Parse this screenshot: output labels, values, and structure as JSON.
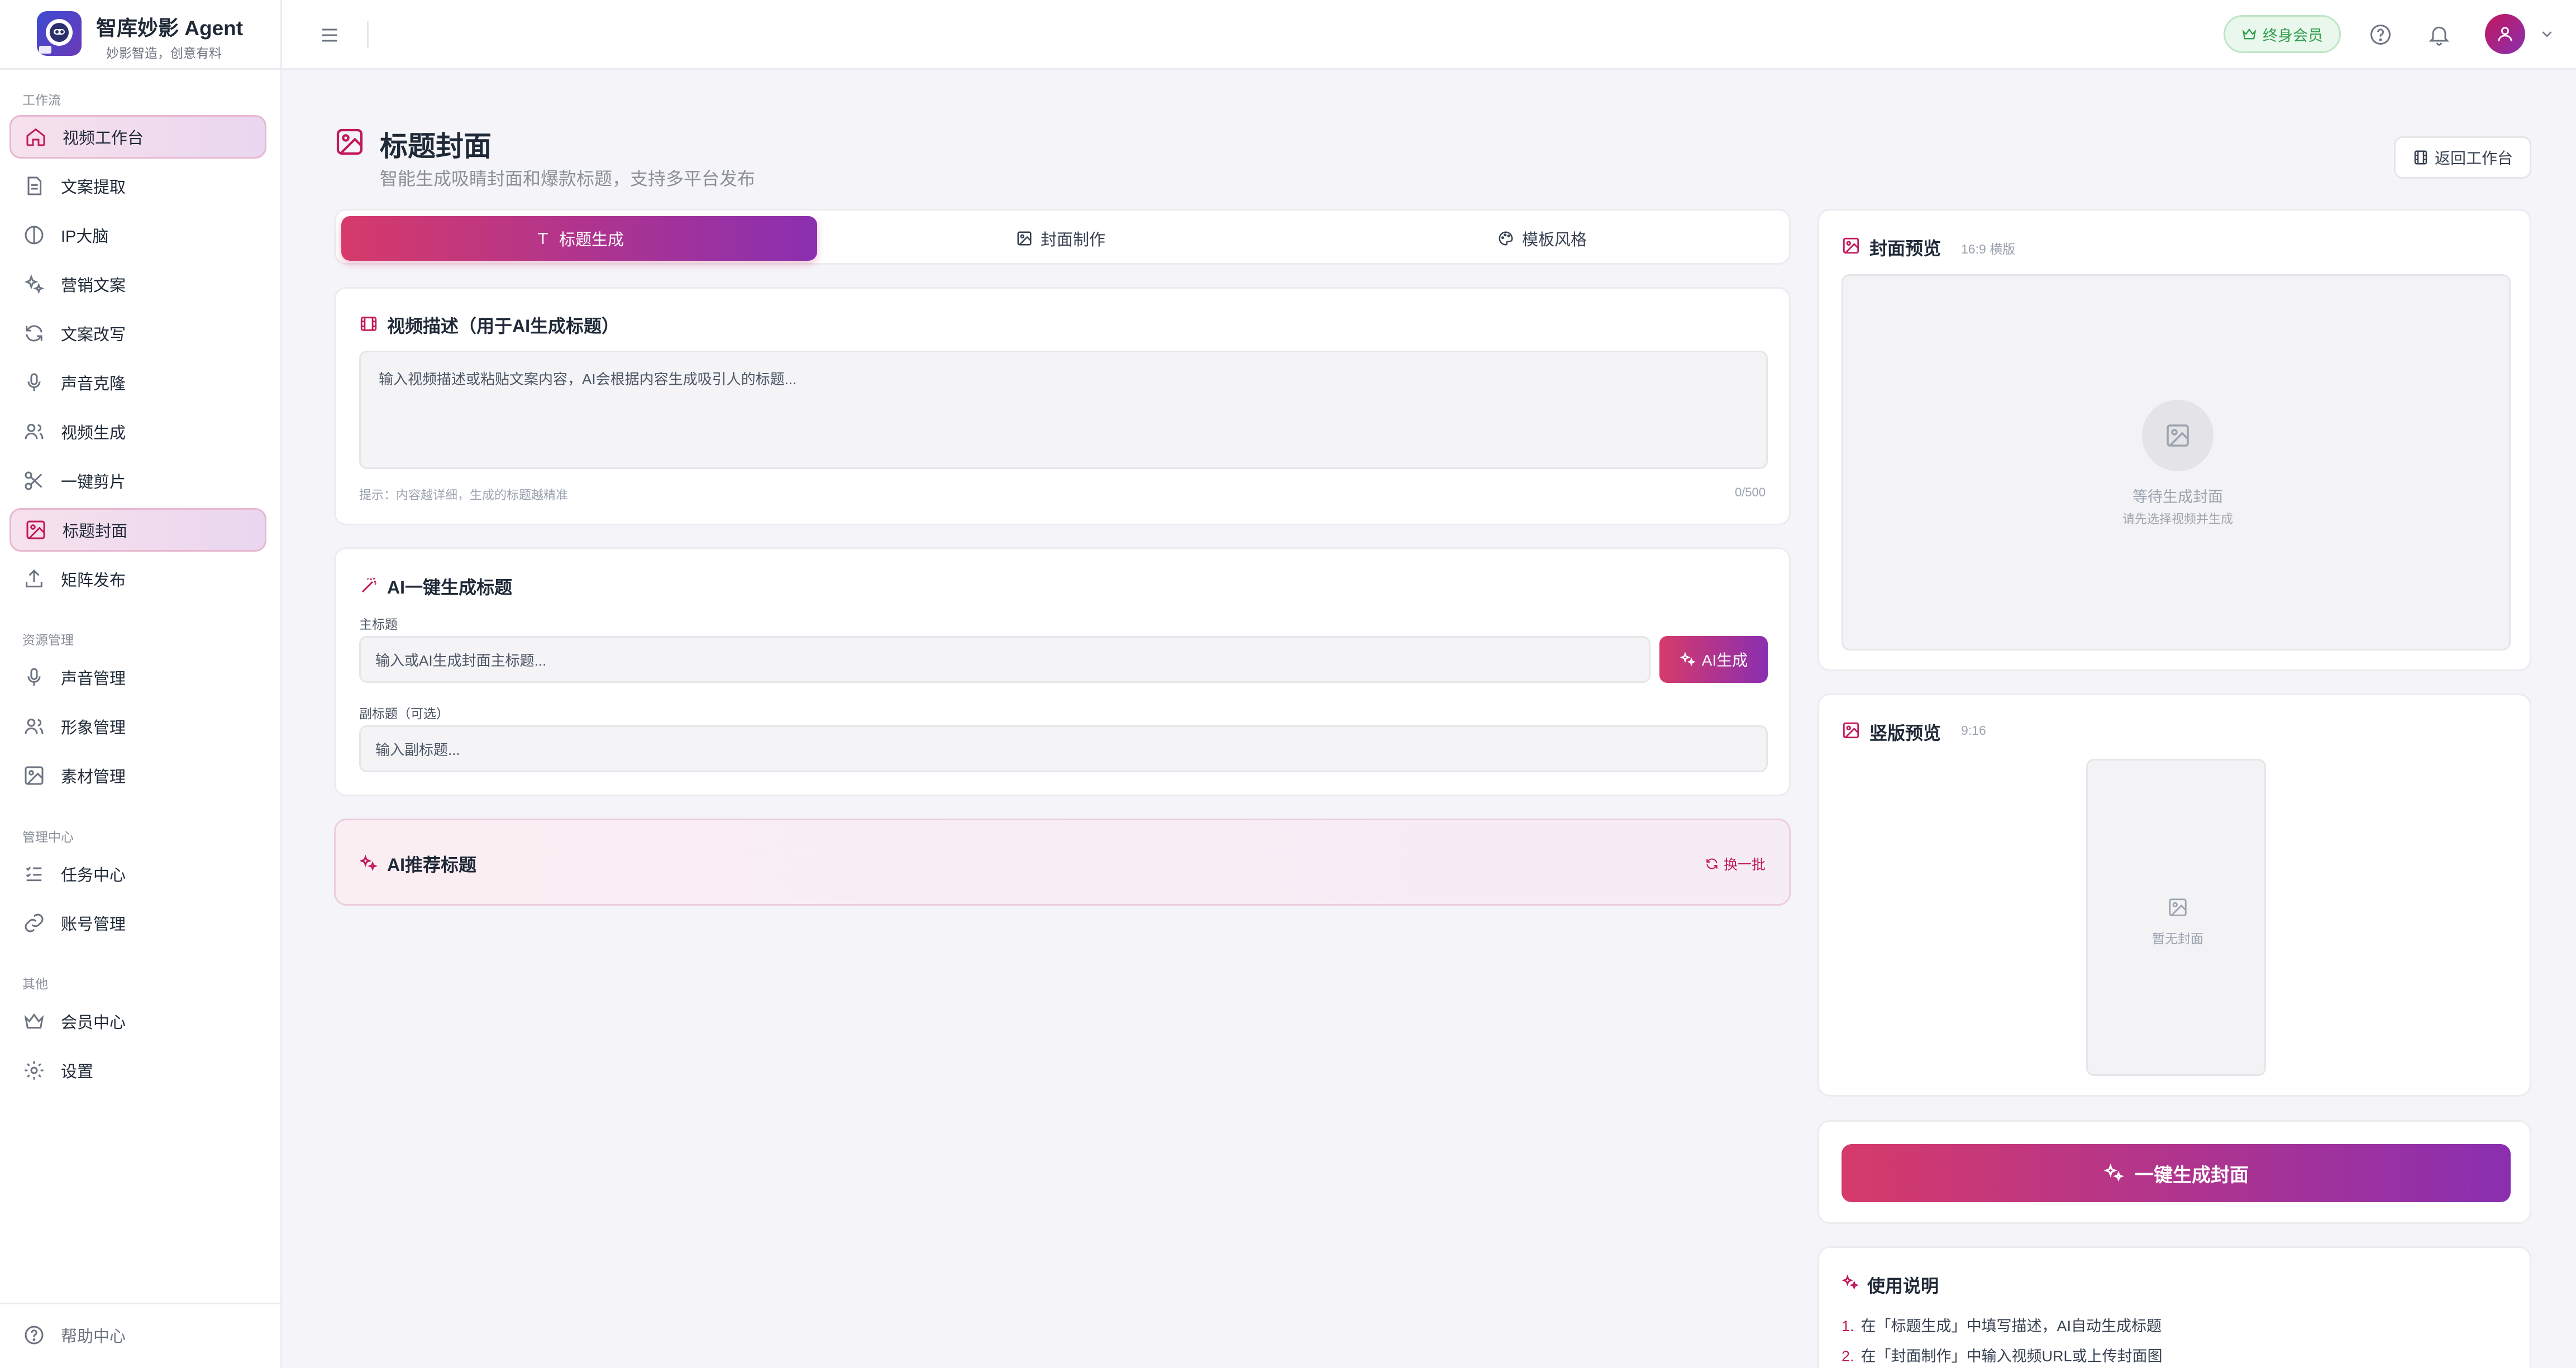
{
  "brand": {
    "title": "智库妙影 Agent",
    "subtitle": "妙影智造，创意有料"
  },
  "sidebar": {
    "sections": [
      "工作流",
      "资源管理",
      "管理中心",
      "其他"
    ],
    "items": [
      {
        "label": "视频工作台",
        "icon": "home-icon"
      },
      {
        "label": "文案提取",
        "icon": "document-icon"
      },
      {
        "label": "IP大脑",
        "icon": "brain-icon"
      },
      {
        "label": "营销文案",
        "icon": "sparkle-icon"
      },
      {
        "label": "文案改写",
        "icon": "refresh-icon"
      },
      {
        "label": "声音克隆",
        "icon": "microphone-icon"
      },
      {
        "label": "视频生成",
        "icon": "users-icon"
      },
      {
        "label": "一键剪片",
        "icon": "scissors-icon"
      },
      {
        "label": "标题封面",
        "icon": "image-icon"
      },
      {
        "label": "矩阵发布",
        "icon": "upload-icon"
      },
      {
        "label": "声音管理",
        "icon": "microphone-icon"
      },
      {
        "label": "形象管理",
        "icon": "users-icon"
      },
      {
        "label": "素材管理",
        "icon": "image-icon"
      },
      {
        "label": "任务中心",
        "icon": "checklist-icon"
      },
      {
        "label": "账号管理",
        "icon": "link-icon"
      },
      {
        "label": "会员中心",
        "icon": "crown-icon"
      },
      {
        "label": "设置",
        "icon": "gear-icon"
      }
    ],
    "help": "帮助中心"
  },
  "topbar": {
    "member_badge": "终身会员"
  },
  "page": {
    "title": "标题封面",
    "subtitle": "智能生成吸睛封面和爆款标题，支持多平台发布",
    "back_button": "返回工作台"
  },
  "tabs": [
    "标题生成",
    "封面制作",
    "模板风格"
  ],
  "video_desc": {
    "title": "视频描述（用于AI生成标题）",
    "placeholder": "输入视频描述或粘贴文案内容，AI会根据内容生成吸引人的标题...",
    "hint": "提示：内容越详细，生成的标题越精准",
    "count": "0/500"
  },
  "ai_title": {
    "title": "AI一键生成标题",
    "main_label": "主标题",
    "main_placeholder": "输入或AI生成封面主标题...",
    "generate_button": "AI生成",
    "sub_label": "副标题（可选）",
    "sub_placeholder": "输入副标题..."
  },
  "recommend": {
    "title": "AI推荐标题",
    "refresh": "换一批"
  },
  "cover_preview": {
    "title": "封面预览",
    "ratio": "16:9 横版",
    "waiting": "等待生成封面",
    "waiting_hint": "请先选择视频并生成"
  },
  "vertical_preview": {
    "title": "竖版预览",
    "ratio": "9:16",
    "empty": "暂无封面"
  },
  "generate_cover_button": "一键生成封面",
  "instructions": {
    "title": "使用说明",
    "items": [
      "在「标题生成」中填写描述，AI自动生成标题",
      "在「封面制作」中输入视频URL或上传封面图"
    ]
  },
  "colors": {
    "accent_start": "#d63a6a",
    "accent_end": "#8a2fb0",
    "brand_pink": "#c2185b"
  }
}
